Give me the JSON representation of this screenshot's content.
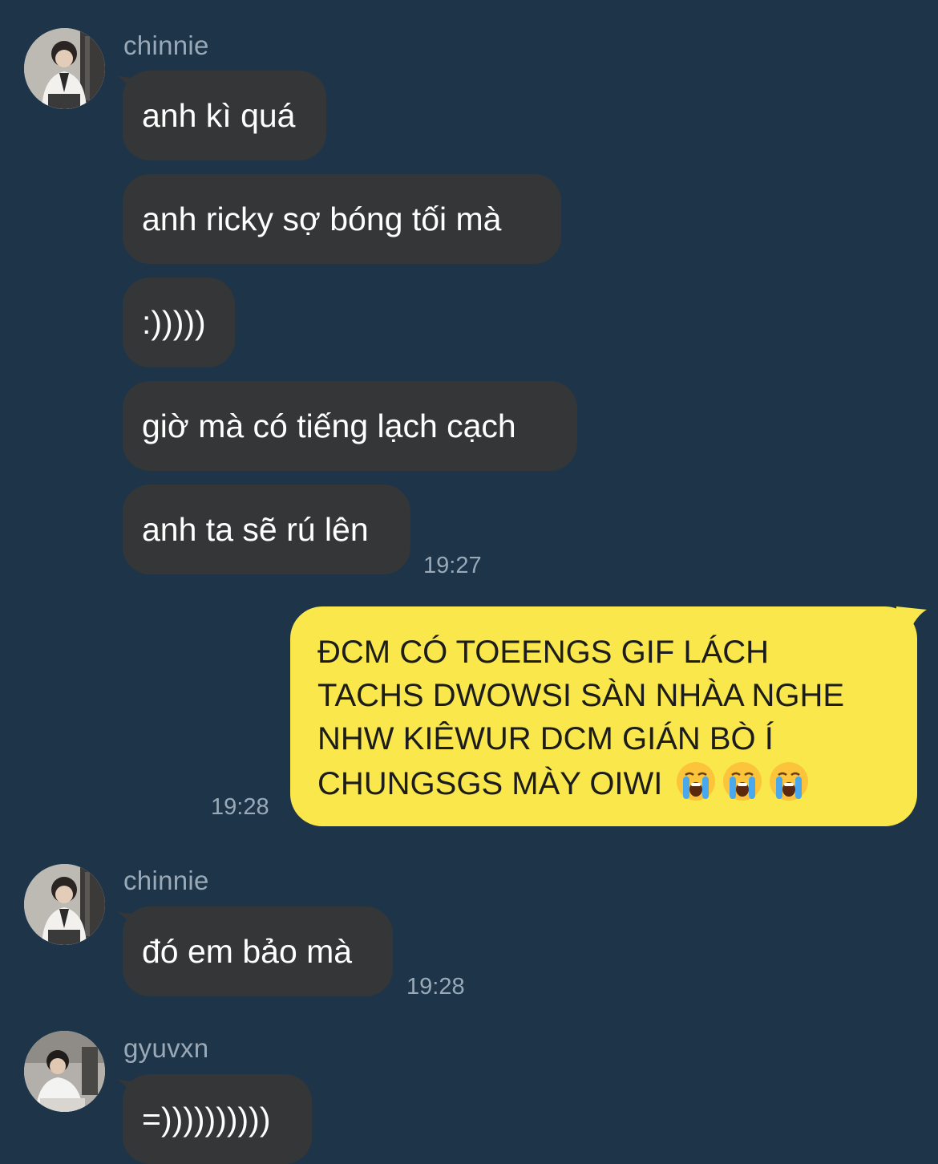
{
  "colors": {
    "background": "#1e3549",
    "incoming_bubble": "#353637",
    "outgoing_bubble": "#f9e74c",
    "meta_text": "#9aa9b7"
  },
  "groups": [
    {
      "sender": "chinnie",
      "messages": [
        "anh kì quá",
        "anh ricky sợ bóng tối mà",
        ":)))))",
        "giờ mà có tiếng lạch cạch",
        "anh ta sẽ rú lên"
      ],
      "time": "19:27"
    },
    {
      "sender": "chinnie",
      "messages": [
        "đó em bảo mà"
      ],
      "time": "19:28"
    },
    {
      "sender": "gyuvxn",
      "messages": [
        "=))))))))))"
      ]
    }
  ],
  "outgoing": {
    "lines": [
      "ĐCM CÓ TOEENGS GIF LÁCH",
      "TACHS DWOWSI SÀN NHÀA NGHE",
      "NHW KIÊWUR DCM GIÁN BÒ Í",
      "CHUNGSGS MÀY OIWI"
    ],
    "emoji": [
      "loudly-crying-face",
      "loudly-crying-face",
      "loudly-crying-face"
    ],
    "time": "19:28"
  }
}
